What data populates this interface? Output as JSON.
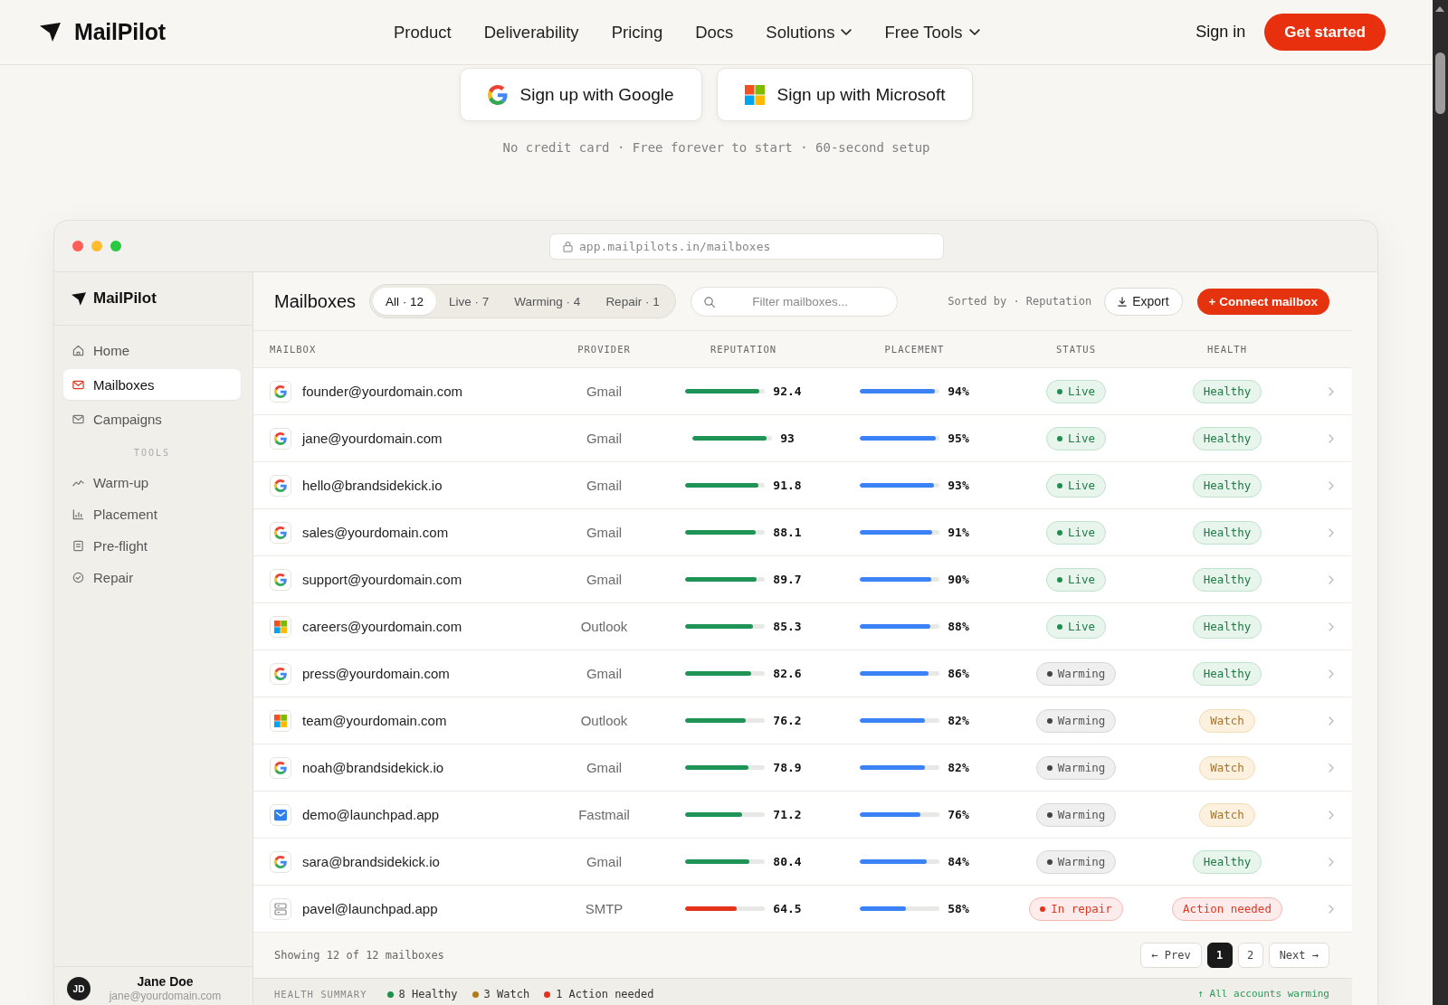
{
  "nav": {
    "logo": "MailPilot",
    "links": [
      {
        "label": "Product",
        "dropdown": false
      },
      {
        "label": "Deliverability",
        "dropdown": false
      },
      {
        "label": "Pricing",
        "dropdown": false
      },
      {
        "label": "Docs",
        "dropdown": false
      },
      {
        "label": "Solutions",
        "dropdown": true
      },
      {
        "label": "Free Tools",
        "dropdown": true
      }
    ],
    "sign_in": "Sign in",
    "cta": "Get started"
  },
  "hero": {
    "signup_buttons": [
      {
        "kind": "google",
        "label": "Sign up with Google"
      },
      {
        "kind": "microsoft",
        "label": "Sign up with Microsoft"
      }
    ],
    "note": "No credit card · Free forever to start · 60-second setup"
  },
  "app": {
    "url": "app.mailpilots.in/mailboxes",
    "sidebar": {
      "logo": "MailPilot",
      "items": [
        {
          "label": "Home",
          "selected": false
        },
        {
          "label": "Mailboxes",
          "selected": true
        },
        {
          "label": "Campaigns",
          "selected": false
        }
      ],
      "section_label": "TOOLS",
      "tools": [
        {
          "label": "Warm-up",
          "selected": false
        },
        {
          "label": "Placement",
          "selected": false
        },
        {
          "label": "Pre-flight",
          "selected": false
        },
        {
          "label": "Repair",
          "selected": false
        }
      ],
      "user": {
        "initials": "JD",
        "name": "Jane Doe",
        "email": "jane@yourdomain.com"
      }
    },
    "toolbar": {
      "title": "Mailboxes",
      "filters": [
        {
          "label": "All · 12",
          "selected": true
        },
        {
          "label": "Live · 7",
          "selected": false
        },
        {
          "label": "Warming · 4",
          "selected": false
        },
        {
          "label": "Repair · 1",
          "selected": false
        }
      ],
      "search": {
        "placeholder": "Filter mailboxes..."
      },
      "sort": "Sorted by · Reputation",
      "export": "Export",
      "connect": "+ Connect mailbox"
    },
    "table": {
      "columns": [
        "MAILBOX",
        "PROVIDER",
        "REPUTATION",
        "PLACEMENT",
        "STATUS",
        "HEALTH"
      ],
      "rows": [
        {
          "kind": "google",
          "mailbox": "founder@yourdomain.com",
          "provider": "Gmail",
          "reputation": {
            "level": 0.924,
            "reading": "92.4",
            "color": "#1f9457"
          },
          "placement": {
            "level": 0.94,
            "reading": "94%"
          },
          "status": {
            "kind": "live",
            "label": "Live"
          },
          "health": {
            "kind": "healthy",
            "label": "Healthy"
          }
        },
        {
          "kind": "google",
          "mailbox": "jane@yourdomain.com",
          "provider": "Gmail",
          "reputation": {
            "level": 0.93,
            "reading": "93",
            "color": "#1f9457"
          },
          "placement": {
            "level": 0.95,
            "reading": "95%"
          },
          "status": {
            "kind": "live",
            "label": "Live"
          },
          "health": {
            "kind": "healthy",
            "label": "Healthy"
          }
        },
        {
          "kind": "google",
          "mailbox": "hello@brandsidekick.io",
          "provider": "Gmail",
          "reputation": {
            "level": 0.918,
            "reading": "91.8",
            "color": "#1f9457"
          },
          "placement": {
            "level": 0.93,
            "reading": "93%"
          },
          "status": {
            "kind": "live",
            "label": "Live"
          },
          "health": {
            "kind": "healthy",
            "label": "Healthy"
          }
        },
        {
          "kind": "google",
          "mailbox": "sales@yourdomain.com",
          "provider": "Gmail",
          "reputation": {
            "level": 0.881,
            "reading": "88.1",
            "color": "#1f9457"
          },
          "placement": {
            "level": 0.91,
            "reading": "91%"
          },
          "status": {
            "kind": "live",
            "label": "Live"
          },
          "health": {
            "kind": "healthy",
            "label": "Healthy"
          }
        },
        {
          "kind": "google",
          "mailbox": "support@yourdomain.com",
          "provider": "Gmail",
          "reputation": {
            "level": 0.897,
            "reading": "89.7",
            "color": "#1f9457"
          },
          "placement": {
            "level": 0.9,
            "reading": "90%"
          },
          "status": {
            "kind": "live",
            "label": "Live"
          },
          "health": {
            "kind": "healthy",
            "label": "Healthy"
          }
        },
        {
          "kind": "microsoft",
          "mailbox": "careers@yourdomain.com",
          "provider": "Outlook",
          "reputation": {
            "level": 0.853,
            "reading": "85.3",
            "color": "#1f9457"
          },
          "placement": {
            "level": 0.88,
            "reading": "88%"
          },
          "status": {
            "kind": "live",
            "label": "Live"
          },
          "health": {
            "kind": "healthy",
            "label": "Healthy"
          }
        },
        {
          "kind": "google",
          "mailbox": "press@yourdomain.com",
          "provider": "Gmail",
          "reputation": {
            "level": 0.826,
            "reading": "82.6",
            "color": "#1f9457"
          },
          "placement": {
            "level": 0.86,
            "reading": "86%"
          },
          "status": {
            "kind": "warming",
            "label": "Warming"
          },
          "health": {
            "kind": "healthy",
            "label": "Healthy"
          }
        },
        {
          "kind": "microsoft",
          "mailbox": "team@yourdomain.com",
          "provider": "Outlook",
          "reputation": {
            "level": 0.762,
            "reading": "76.2",
            "color": "#1f9457"
          },
          "placement": {
            "level": 0.82,
            "reading": "82%"
          },
          "status": {
            "kind": "warming",
            "label": "Warming"
          },
          "health": {
            "kind": "watch",
            "label": "Watch"
          }
        },
        {
          "kind": "google",
          "mailbox": "noah@brandsidekick.io",
          "provider": "Gmail",
          "reputation": {
            "level": 0.789,
            "reading": "78.9",
            "color": "#1f9457"
          },
          "placement": {
            "level": 0.82,
            "reading": "82%"
          },
          "status": {
            "kind": "warming",
            "label": "Warming"
          },
          "health": {
            "kind": "watch",
            "label": "Watch"
          }
        },
        {
          "kind": "fastmail",
          "mailbox": "demo@launchpad.app",
          "provider": "Fastmail",
          "reputation": {
            "level": 0.712,
            "reading": "71.2",
            "color": "#1f9457"
          },
          "placement": {
            "level": 0.76,
            "reading": "76%"
          },
          "status": {
            "kind": "warming",
            "label": "Warming"
          },
          "health": {
            "kind": "watch",
            "label": "Watch"
          }
        },
        {
          "kind": "google",
          "mailbox": "sara@brandsidekick.io",
          "provider": "Gmail",
          "reputation": {
            "level": 0.804,
            "reading": "80.4",
            "color": "#1f9457"
          },
          "placement": {
            "level": 0.84,
            "reading": "84%"
          },
          "status": {
            "kind": "warming",
            "label": "Warming"
          },
          "health": {
            "kind": "healthy",
            "label": "Healthy"
          }
        },
        {
          "kind": "smtp",
          "mailbox": "pavel@launchpad.app",
          "provider": "SMTP",
          "reputation": {
            "level": 0.645,
            "reading": "64.5",
            "color": "#e5321b"
          },
          "placement": {
            "level": 0.58,
            "reading": "58%"
          },
          "status": {
            "kind": "repair",
            "label": "In repair"
          },
          "health": {
            "kind": "action",
            "label": "Action needed"
          }
        }
      ],
      "footer": {
        "showing": "Showing 12 of 12 mailboxes",
        "prev": "← Prev",
        "pages": [
          {
            "label": "1",
            "selected": true
          },
          {
            "label": "2",
            "selected": false
          }
        ],
        "next": "Next →"
      }
    },
    "health_summary": {
      "label": "HEALTH SUMMARY",
      "items": [
        {
          "label": "8 Healthy",
          "color": "#1f8f4e"
        },
        {
          "label": "3 Watch",
          "color": "#b07a1e"
        },
        {
          "label": "1 Action needed",
          "color": "#e5321b"
        }
      ],
      "trend": "↑ All accounts warming"
    }
  }
}
